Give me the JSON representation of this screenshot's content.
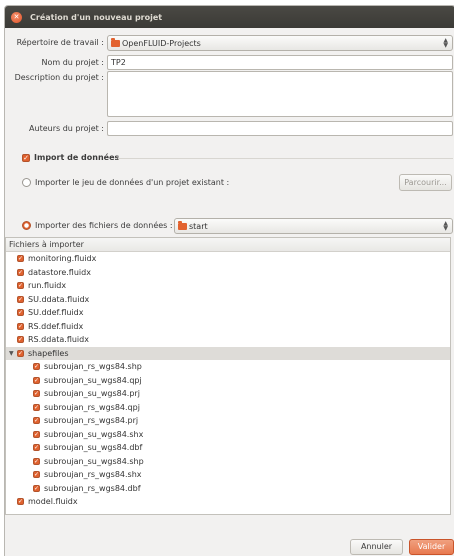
{
  "window": {
    "title": "Création d'un nouveau projet"
  },
  "form": {
    "workdir_label": "Répertoire de travail :",
    "workdir_value": "OpenFLUID-Projects",
    "name_label": "Nom du projet :",
    "name_value": "TP2",
    "description_label": "Description du projet :",
    "description_value": "",
    "authors_label": "Auteurs du projet :",
    "authors_value": ""
  },
  "import": {
    "section_label": "Import de données",
    "section_checked": true,
    "option_project_label": "Importer le jeu de données d'un projet existant :",
    "option_project_selected": false,
    "browse_label": "Parcourir...",
    "option_files_label": "Importer des fichiers de données :",
    "option_files_selected": true,
    "files_dir_value": "start"
  },
  "file_list": {
    "header": "Fichiers à importer",
    "items": [
      {
        "label": "monitoring.fluidx",
        "checked": true,
        "level": 1
      },
      {
        "label": "datastore.fluidx",
        "checked": true,
        "level": 1
      },
      {
        "label": "run.fluidx",
        "checked": true,
        "level": 1
      },
      {
        "label": "SU.ddata.fluidx",
        "checked": true,
        "level": 1
      },
      {
        "label": "SU.ddef.fluidx",
        "checked": true,
        "level": 1
      },
      {
        "label": "RS.ddef.fluidx",
        "checked": true,
        "level": 1
      },
      {
        "label": "RS.ddata.fluidx",
        "checked": true,
        "level": 1
      },
      {
        "label": "shapefiles",
        "checked": true,
        "level": 0,
        "folder": true,
        "expanded": true
      },
      {
        "label": "subroujan_rs_wgs84.shp",
        "checked": true,
        "level": 2
      },
      {
        "label": "subroujan_su_wgs84.qpj",
        "checked": true,
        "level": 2
      },
      {
        "label": "subroujan_su_wgs84.prj",
        "checked": true,
        "level": 2
      },
      {
        "label": "subroujan_rs_wgs84.qpj",
        "checked": true,
        "level": 2
      },
      {
        "label": "subroujan_rs_wgs84.prj",
        "checked": true,
        "level": 2
      },
      {
        "label": "subroujan_su_wgs84.shx",
        "checked": true,
        "level": 2
      },
      {
        "label": "subroujan_su_wgs84.dbf",
        "checked": true,
        "level": 2
      },
      {
        "label": "subroujan_su_wgs84.shp",
        "checked": true,
        "level": 2
      },
      {
        "label": "subroujan_rs_wgs84.shx",
        "checked": true,
        "level": 2
      },
      {
        "label": "subroujan_rs_wgs84.dbf",
        "checked": true,
        "level": 2
      },
      {
        "label": "model.fluidx",
        "checked": true,
        "level": 1
      }
    ]
  },
  "footer": {
    "cancel_label": "Annuler",
    "ok_label": "Valider"
  },
  "colors": {
    "accent": "#e0622f",
    "titlebar": "#3c3b37",
    "window_bg": "#f2f1f0"
  },
  "icons": {
    "close": "close-icon",
    "folder": "folder-icon",
    "checkbox": "checkbox-icon",
    "radio": "radio-icon",
    "combo_arrow": "updown-arrow-icon",
    "expander": "expander-icon"
  }
}
